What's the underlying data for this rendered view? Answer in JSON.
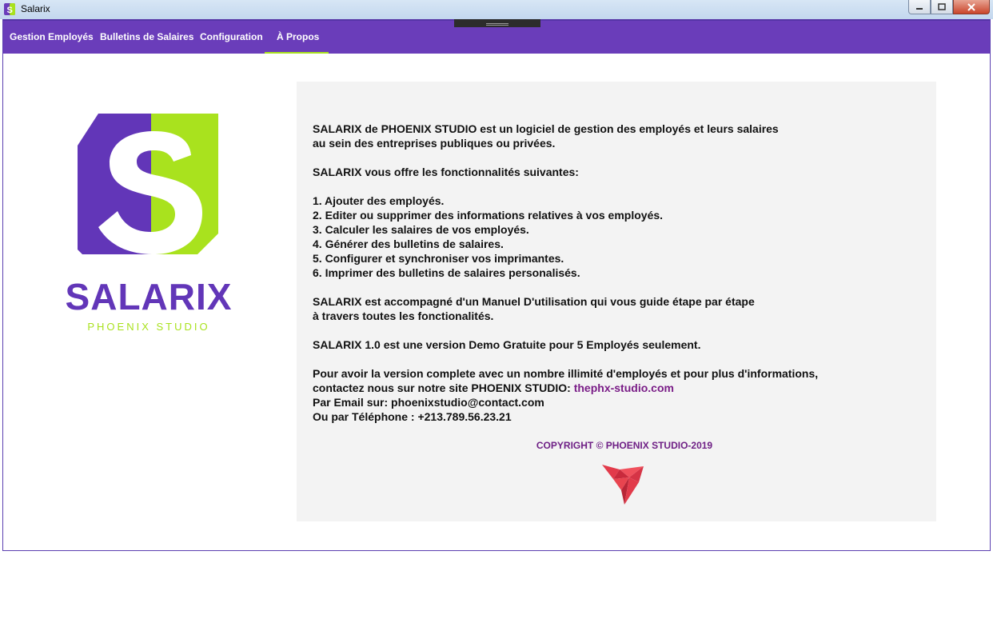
{
  "window": {
    "title": "Salarix"
  },
  "menu": [
    {
      "label": "Gestion Employés"
    },
    {
      "label": "Bulletins de Salaires"
    },
    {
      "label": "Configuration"
    },
    {
      "label": "À Propos",
      "active": true
    }
  ],
  "brand": {
    "name": "SALARIX",
    "subtitle": "PHOENIX STUDIO"
  },
  "about": {
    "intro1": "SALARIX de PHOENIX STUDIO est un logiciel de gestion des employés et leurs salaires",
    "intro2": "au sein des entreprises publiques ou privées.",
    "features_title": "SALARIX vous offre les fonctionnalités suivantes:",
    "features": [
      "1. Ajouter des employés.",
      "2. Editer ou supprimer des informations relatives à vos employés.",
      "3. Calculer les salaires de vos employés.",
      "4. Générer des bulletins de salaires.",
      "5. Configurer et synchroniser vos imprimantes.",
      "6. Imprimer des bulletins de salaires personalisés."
    ],
    "manual1": "SALARIX est accompagné d'un Manuel D'utilisation qui vous guide étape par étape",
    "manual2": "à travers toutes les fonctionalités.",
    "demo": "SALARIX 1.0 est une version Demo Gratuite pour 5 Employés seulement.",
    "contact1": "Pour avoir la version complete avec un nombre illimité d'employés et pour plus d'informations,",
    "contact2_prefix": "contactez nous sur notre site PHOENIX STUDIO: ",
    "site": "thephx-studio.com",
    "email_line": "Par Email sur: phoenixstudio@contact.com",
    "phone_line": "Ou par Téléphone : +213.789.56.23.21",
    "copyright": "COPYRIGHT © PHOENIX STUDIO-2019"
  },
  "colors": {
    "accent": "#6a3dba",
    "lime": "#a9e21e",
    "phoenix": "#e23a4a"
  }
}
